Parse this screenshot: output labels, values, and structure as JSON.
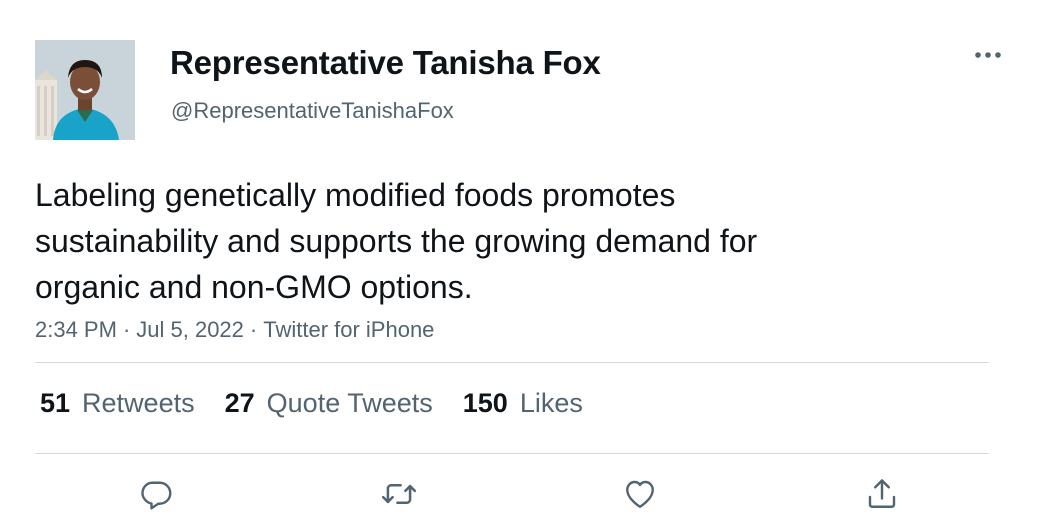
{
  "author": {
    "display_name": "Representative Tanisha Fox",
    "handle": "@RepresentativeTanishaFox"
  },
  "tweet": {
    "text_lines": [
      "Labeling genetically modified foods promotes",
      "sustainability and supports the growing demand for",
      "organic and non-GMO options."
    ],
    "time": "2:34 PM",
    "separator": "·",
    "date": "Jul 5, 2022",
    "source": "Twitter for iPhone"
  },
  "stats": {
    "retweets_count": "51",
    "retweets_label": "Retweets",
    "quotes_count": "27",
    "quotes_label": "Quote Tweets",
    "likes_count": "150",
    "likes_label": "Likes"
  },
  "icons": {
    "more": "more-horizontal-icon",
    "reply": "reply-icon",
    "retweet": "retweet-icon",
    "like": "heart-icon",
    "share": "share-icon"
  },
  "colors": {
    "text_primary": "#0f1419",
    "text_secondary": "#536471",
    "divider": "#cfd9de",
    "icon": "#536471",
    "avatar_jacket": "#19a3c9"
  }
}
